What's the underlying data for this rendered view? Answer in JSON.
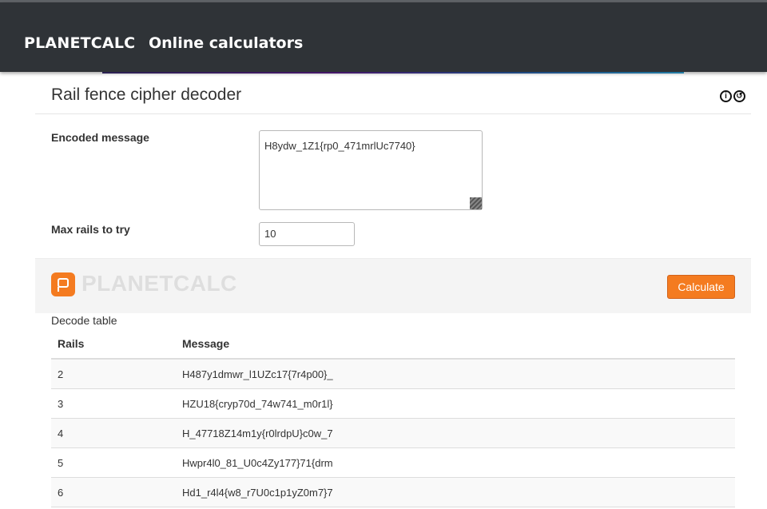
{
  "navbar": {
    "brand": "PLANETCALC",
    "link": "Online calculators"
  },
  "calculator": {
    "title": "Rail fence cipher decoder",
    "encoded_label": "Encoded message",
    "encoded_value": "H8ydw_1Z1{rp0_471mrlUc7740}",
    "rails_label": "Max rails to try",
    "rails_value": "10",
    "logo_text": "PLANETCALC",
    "calculate_label": "Calculate"
  },
  "result": {
    "caption": "Decode table",
    "headers": [
      "Rails",
      "Message"
    ],
    "rows": [
      {
        "rails": "2",
        "message": "H487y1dmwr_l1UZc17{7r4p00}_"
      },
      {
        "rails": "3",
        "message": "HZU18{cryp70d_74w741_m0r1l}"
      },
      {
        "rails": "4",
        "message": "H_47718Z14m1y{r0lrdpU}c0w_7"
      },
      {
        "rails": "5",
        "message": "Hwpr4l0_81_U0c4Zy177}71{drm"
      },
      {
        "rails": "6",
        "message": "Hd1_r4l4{w8_r7U0c1p1yZ0m7}7"
      }
    ]
  },
  "colors": {
    "navbar": "#2f3337",
    "accent": "#f47b20"
  },
  "icons": [
    "info-icon",
    "refresh-icon"
  ]
}
